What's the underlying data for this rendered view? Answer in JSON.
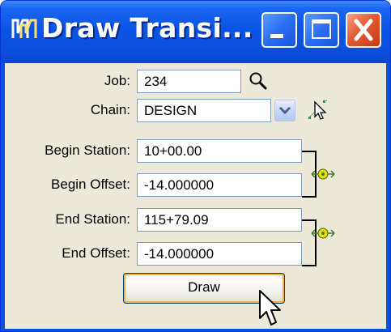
{
  "window": {
    "title": "Draw Transi...",
    "buttons": {
      "minimize": "minimize",
      "maximize": "maximize",
      "close": "close"
    }
  },
  "form": {
    "job_label": "Job:",
    "job_value": "234",
    "chain_label": "Chain:",
    "chain_value": "DESIGN",
    "begin_station_label": "Begin Station:",
    "begin_station_value": "10+00.00",
    "begin_offset_label": "Begin Offset:",
    "begin_offset_value": "-14.000000",
    "end_station_label": "End Station:",
    "end_station_value": "115+79.09",
    "end_offset_label": "End Offset:",
    "end_offset_value": "-14.000000",
    "draw_label": "Draw"
  },
  "icons": {
    "app": "app-icon",
    "search": "magnifier-icon",
    "dropdown": "chevron-down-icon",
    "pick": "pick-element-icon",
    "lock": "lock-link-icon",
    "cursor": "mouse-pointer-icon"
  },
  "colors": {
    "titlebar": "#0a55e6",
    "face": "#ece9d8",
    "close": "#e35a34",
    "lock": "#e8e000"
  }
}
